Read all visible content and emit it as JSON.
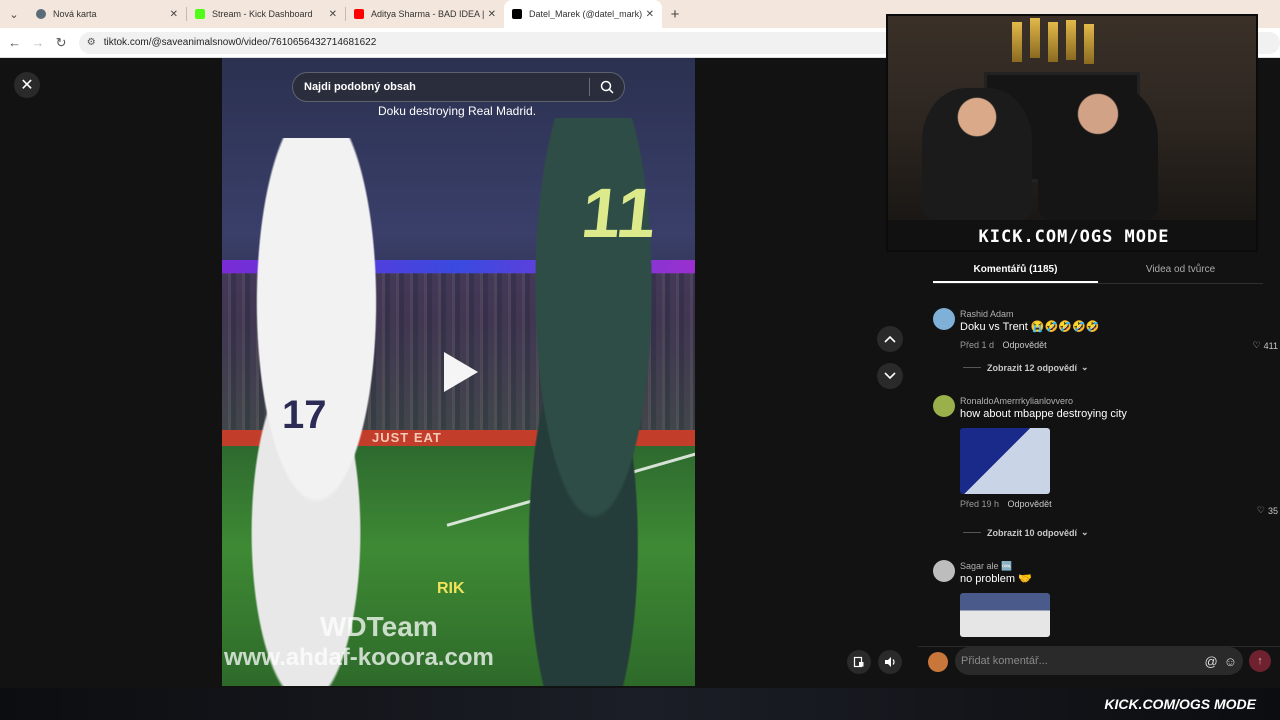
{
  "browser": {
    "tabs": [
      {
        "title": "Nová karta",
        "favicon_color": "#5a6b7a",
        "active": false
      },
      {
        "title": "Stream - Kick Dashboard",
        "favicon_color": "#53fc18",
        "active": false
      },
      {
        "title": "Aditya Sharma - BAD IDEA | Ele",
        "favicon_color": "#ff0000",
        "active": false
      },
      {
        "title": "Datel_Marek (@datel_mark) | Ti",
        "favicon_color": "#000000",
        "active": true
      }
    ],
    "url": "tiktok.com/@saveanimalsnow0/video/7610656432714681622"
  },
  "video": {
    "search_placeholder": "Najdi podobný obsah",
    "caption": "Doku destroying Real Madrid.",
    "number_right": "11",
    "number_left": "17",
    "ad_text": "JUST EAT",
    "watermark_top": "WDTeam",
    "watermark_bottom": "www.ahdaf-kooora.com",
    "watermark_logo": "RIK"
  },
  "comments_panel": {
    "tabs": [
      "Komentářů (1185)",
      "Videa od tvůrce"
    ],
    "comments": [
      {
        "author": "Rashid Adam",
        "text": "Doku vs Trent 😭🤣🤣🤣🤣",
        "time": "Před 1 d",
        "reply": "Odpovědět",
        "likes": "411",
        "more_replies": "Zobrazit 12 odpovědí",
        "avatar_color": "#7fb0d8"
      },
      {
        "author": "RonaldoAmerrrkylianlovvero",
        "text": "how about mbappe destroying city",
        "time": "Před 19 h",
        "reply": "Odpovědět",
        "likes": "35",
        "more_replies": "Zobrazit 10 odpovědí",
        "avatar_color": "#9ab04a"
      },
      {
        "author": "Sagar ale 🆒",
        "text": "no problem 🤝",
        "avatar_color": "#bdbdbd"
      }
    ],
    "input_placeholder": "Přidat komentář..."
  },
  "stream_overlay": {
    "banner": "KICK.COM/OGS MODE",
    "bottom_brand": "KICK.COM/OGS MODE"
  }
}
